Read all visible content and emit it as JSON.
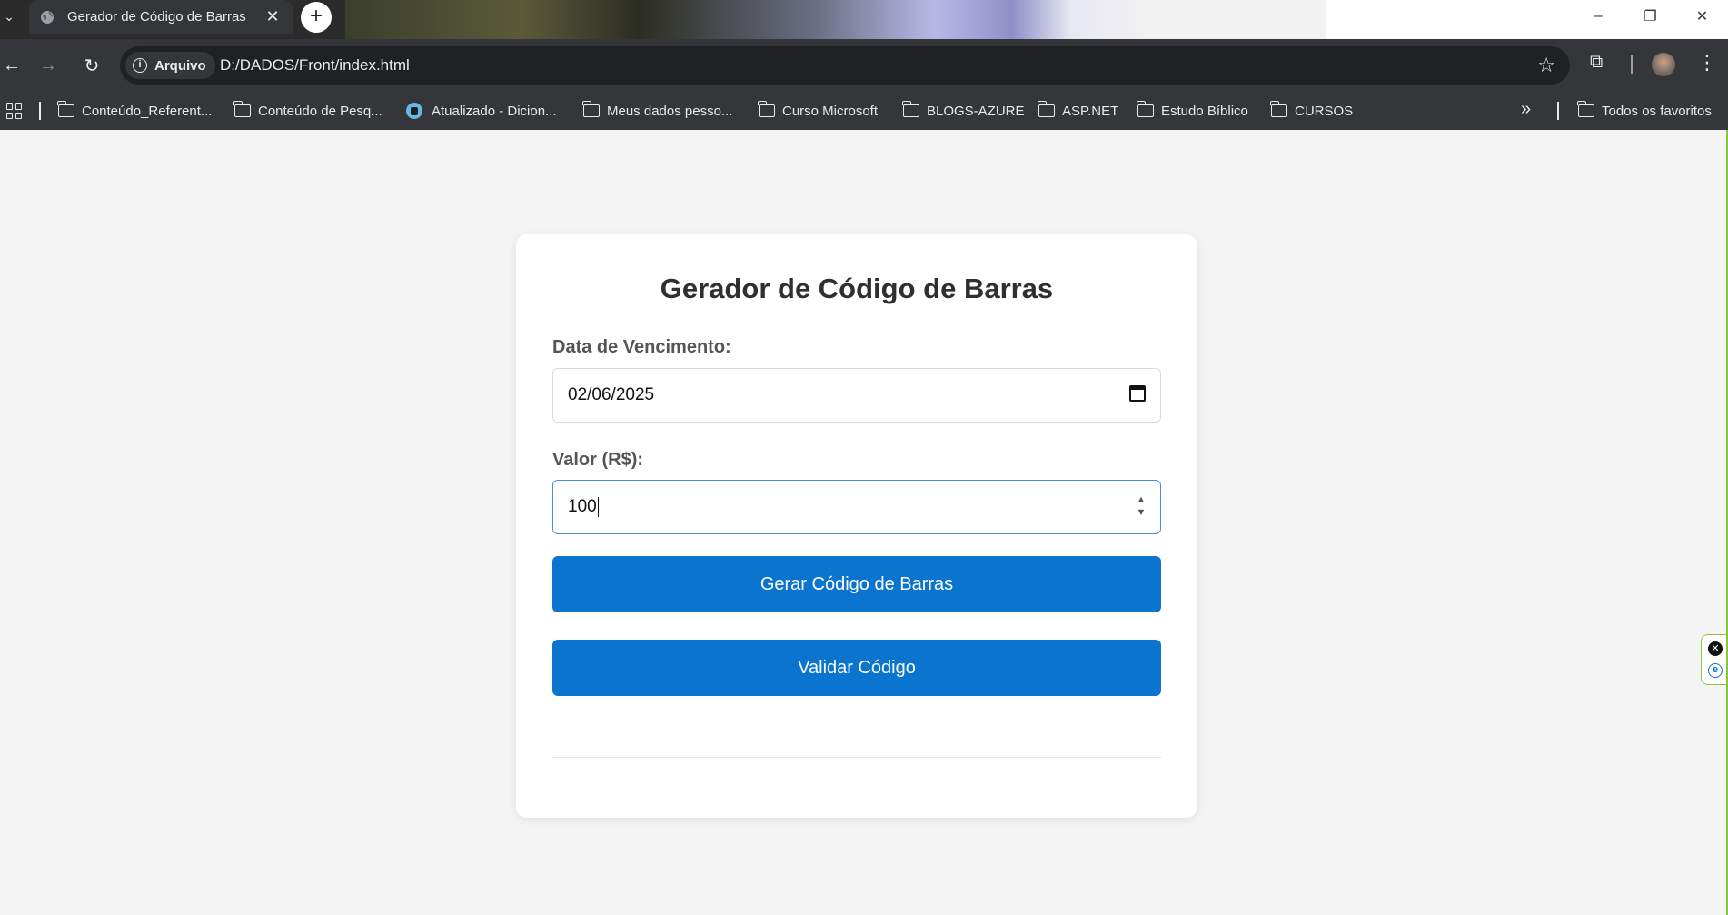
{
  "browser": {
    "tab_title": "Gerador de Código de Barras",
    "tab_close": "✕",
    "new_tab": "+",
    "security_chip": "Arquivo",
    "url": "D:/DADOS/Front/index.html",
    "window_controls": {
      "minimize": "–",
      "restore": "❐",
      "close": "✕"
    }
  },
  "bookmarks": {
    "items": [
      {
        "label": "Conteúdo_Referent...",
        "icon": "folder-icon"
      },
      {
        "label": "Conteúdo de Pesq...",
        "icon": "folder-icon"
      },
      {
        "label": "Atualizado - Dicion...",
        "icon": "dictionary-site-icon"
      },
      {
        "label": "Meus dados pesso...",
        "icon": "folder-icon"
      },
      {
        "label": "Curso Microsoft",
        "icon": "folder-icon"
      },
      {
        "label": "BLOGS-AZURE",
        "icon": "folder-icon"
      },
      {
        "label": "ASP.NET",
        "icon": "folder-icon"
      },
      {
        "label": "Estudo Bíblico",
        "icon": "folder-icon"
      },
      {
        "label": "CURSOS",
        "icon": "folder-icon"
      }
    ],
    "overflow": "»",
    "all_bookmarks": "Todos os favoritos"
  },
  "form": {
    "title": "Gerador de Código de Barras",
    "due_date_label": "Data de Vencimento:",
    "due_date_value": "02/06/2025",
    "amount_label": "Valor (R$):",
    "amount_value": "100",
    "generate_button": "Gerar Código de Barras",
    "validate_button": "Validar Código"
  },
  "colors": {
    "primary_button": "#0a74cf",
    "page_background": "#f4f4f4",
    "card_background": "#ffffff"
  }
}
